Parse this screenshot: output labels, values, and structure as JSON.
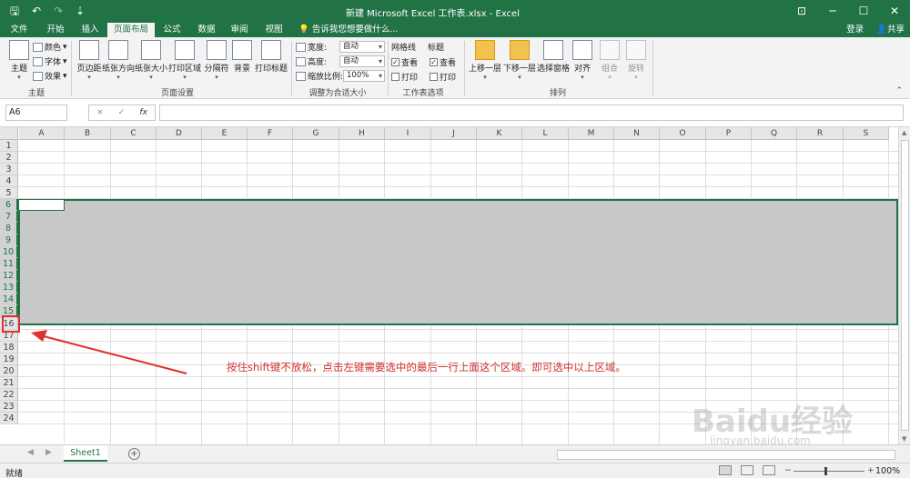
{
  "window": {
    "title": "新建 Microsoft Excel 工作表.xlsx - Excel"
  },
  "tabs": [
    "文件",
    "开始",
    "插入",
    "页面布局",
    "公式",
    "数据",
    "审阅",
    "视图"
  ],
  "tell_me": "告诉我您想要做什么...",
  "account": {
    "login": "登录",
    "share": "共享"
  },
  "ribbon": {
    "theme_group": {
      "label": "主题",
      "themes": "主题",
      "colors": "颜色",
      "fonts": "字体",
      "effects": "效果"
    },
    "page_setup": {
      "label": "页面设置",
      "buttons": [
        "页边距",
        "纸张方向",
        "纸张大小",
        "打印区域",
        "分隔符",
        "背景",
        "打印标题"
      ]
    },
    "scale": {
      "label": "调整为合适大小",
      "width_label": "宽度:",
      "width_value": "自动",
      "height_label": "高度:",
      "height_value": "自动",
      "scale_label": "缩放比例:",
      "scale_value": "100%"
    },
    "sheet_options": {
      "label": "工作表选项",
      "gridlines": "网格线",
      "headings": "标题",
      "view": "查看",
      "print": "打印"
    },
    "arrange": {
      "label": "排列",
      "buttons": [
        "上移一层",
        "下移一层",
        "选择窗格",
        "对齐",
        "组合",
        "旋转"
      ]
    }
  },
  "formula_bar": {
    "name_box": "A6",
    "fx": "fx",
    "cancel": "×",
    "enter": "✓",
    "value": ""
  },
  "columns": [
    "A",
    "B",
    "C",
    "D",
    "E",
    "F",
    "G",
    "H",
    "I",
    "J",
    "K",
    "L",
    "M",
    "N",
    "O",
    "P",
    "Q",
    "R",
    "S"
  ],
  "rows": [
    "1",
    "2",
    "3",
    "4",
    "5",
    "6",
    "7",
    "8",
    "9",
    "10",
    "11",
    "12",
    "13",
    "14",
    "15",
    "16",
    "17",
    "18",
    "19",
    "20",
    "21",
    "22",
    "23",
    "24"
  ],
  "annotation": "按住shift键不放松，点击左键需要选中的最后一行上面这个区域。即可选中以上区域。",
  "watermark": {
    "main": "Baidu经验",
    "sub": "jingyan.baidu.com"
  },
  "sheet_tab": "Sheet1",
  "status": {
    "text": "就绪",
    "zoom": "100%"
  },
  "colors": {
    "excel_green": "#217346",
    "selection": "#c8c8c8",
    "highlight_red": "#e03030"
  }
}
